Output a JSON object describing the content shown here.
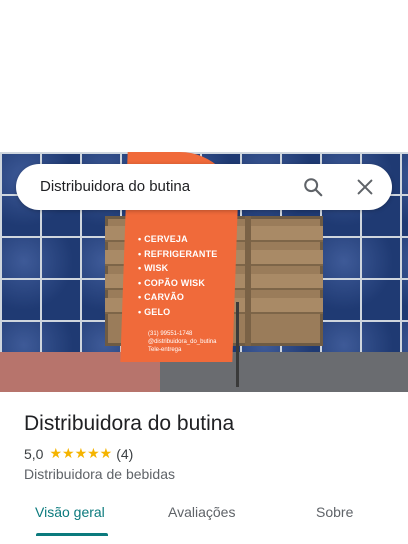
{
  "search": {
    "query": "Distribuidora do butina"
  },
  "place": {
    "name": "Distribuidora do butina",
    "rating": "5,0",
    "stars_glyphs": "★★★★★",
    "review_count": "(4)",
    "category": "Distribuidora de bebidas"
  },
  "photo": {
    "flag_items": [
      "CERVEJA",
      "REFRIGERANTE",
      "WISK",
      "COPÃO WISK",
      "CARVÃO",
      "GELO"
    ],
    "flag_phone": "(31) 99551-1748",
    "flag_handle": "@distribuidora_do_butina",
    "flag_extra": "Tele-entrega"
  },
  "tabs": [
    "Visão geral",
    "Avaliações",
    "Sobre"
  ],
  "colors": {
    "accent": "#0b7a7d",
    "star": "#f5b400",
    "flag": "#f06a3a"
  },
  "icons": {
    "search": "search-icon",
    "close": "close-icon"
  }
}
